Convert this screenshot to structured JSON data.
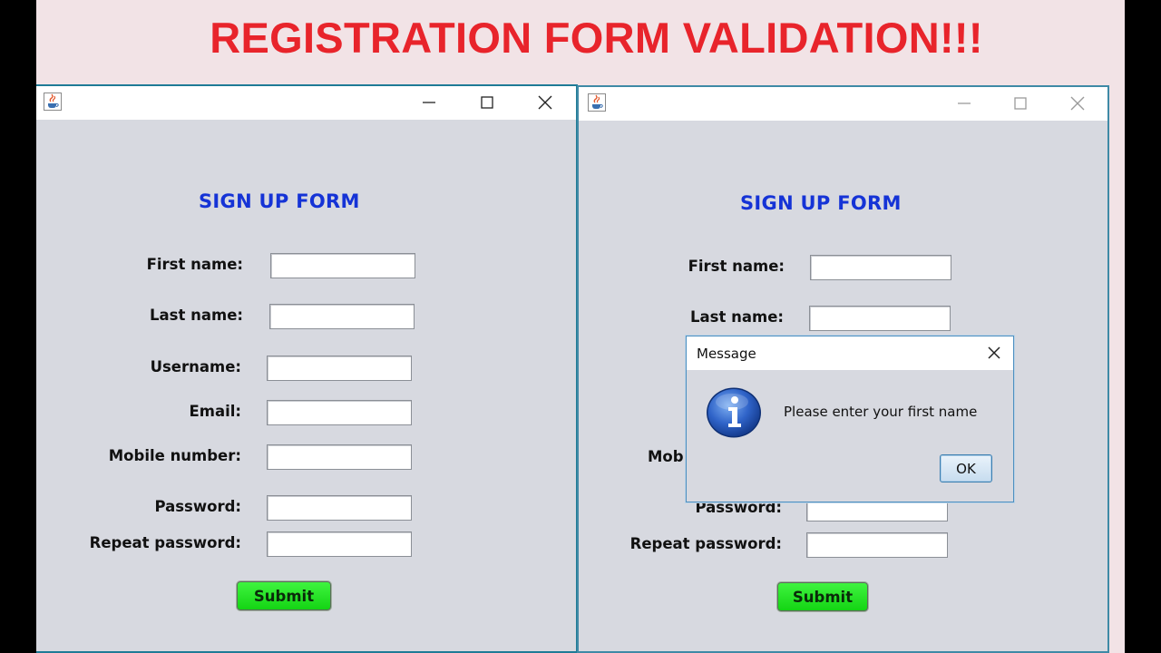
{
  "headline": "REGISTRATION FORM VALIDATION!!!",
  "colors": {
    "headline": "#e8242b",
    "form_title": "#1533d6",
    "submit": "#22e022",
    "window_bg": "#d7d9e0",
    "window_border": "#1f7b96"
  },
  "icons": {
    "window": "java-cup-icon",
    "minimize": "minimize-icon",
    "maximize": "maximize-icon",
    "close": "close-icon",
    "dialog": "info-icon"
  },
  "left_window": {
    "form_title": "SIGN UP FORM",
    "labels": {
      "first_name": "First name:",
      "last_name": "Last name:",
      "username": "Username:",
      "email": "Email:",
      "mobile": "Mobile number:",
      "password": "Password:",
      "repeat_password": "Repeat password:"
    },
    "submit_label": "Submit"
  },
  "right_window": {
    "form_title": "SIGN UP FORM",
    "labels": {
      "first_name": "First name:",
      "last_name": "Last name:",
      "mobile_partial": "Mob",
      "password": "Password:",
      "repeat_password": "Repeat password:"
    },
    "submit_label": "Submit"
  },
  "dialog": {
    "title": "Message",
    "message": "Please enter your first name",
    "ok_label": "OK"
  }
}
